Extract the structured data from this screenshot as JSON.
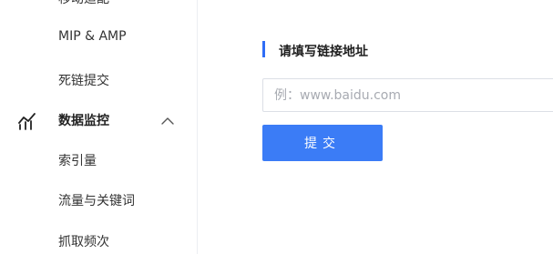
{
  "sidebar": {
    "items_before": [
      {
        "label": "移动适配"
      },
      {
        "label": "MIP & AMP"
      },
      {
        "label": "死链提交"
      }
    ],
    "group": {
      "label": "数据监控",
      "icon": "chart-line-icon",
      "expanded": true
    },
    "subitems": [
      {
        "label": "索引量"
      },
      {
        "label": "流量与关键词"
      },
      {
        "label": "抓取频次"
      }
    ]
  },
  "main": {
    "section_title": "请填写链接地址",
    "url_input": {
      "value": "",
      "placeholder": "例：www.baidu.com"
    },
    "submit_label": "提交"
  },
  "colors": {
    "accent": "#3b7cf6",
    "title_bar": "#2f6df6",
    "border": "#dcdfe6",
    "text": "#333333"
  }
}
